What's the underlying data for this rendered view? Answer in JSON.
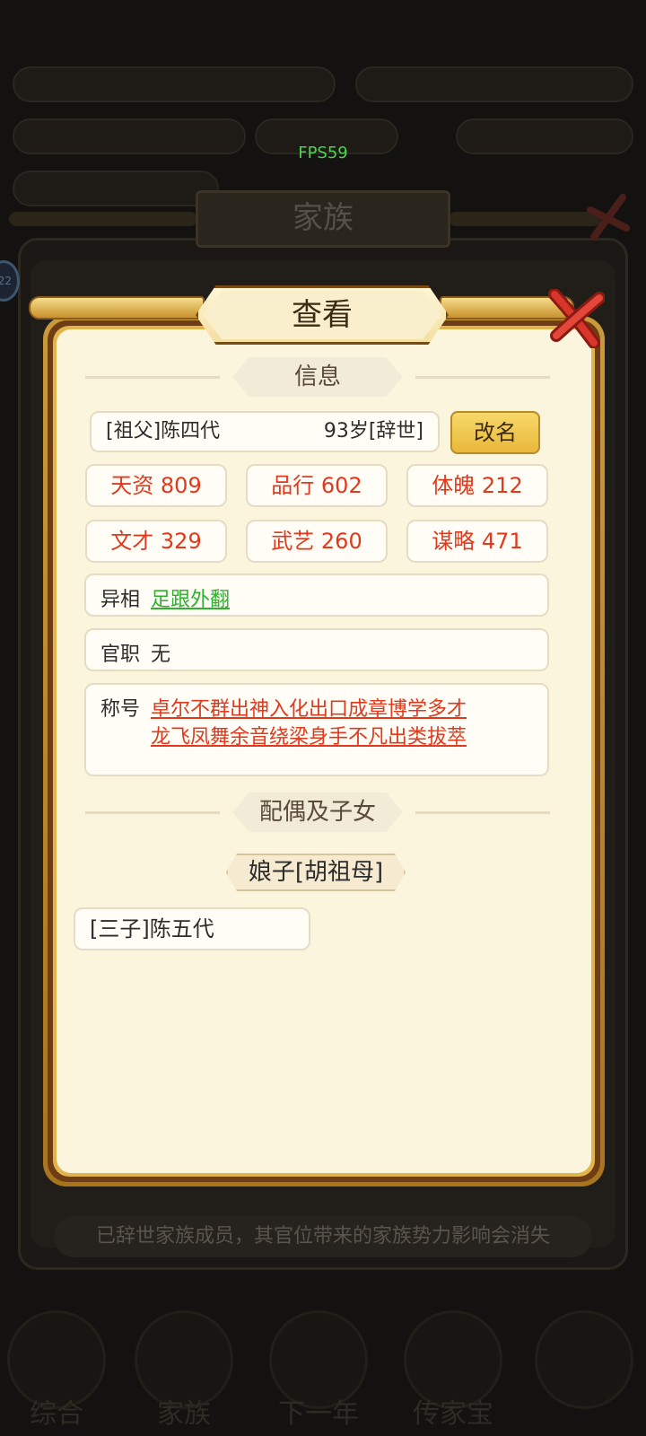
{
  "fps": "FPS59",
  "background": {
    "window_title": "家族",
    "notice": "已辞世家族成员，其官位带来的家族势力影响会消失",
    "nav_labels": [
      "综合",
      "家族",
      "下一年",
      "传家宝",
      "..."
    ]
  },
  "dialog": {
    "title": "查看",
    "section_info": "信息",
    "member": {
      "name": "[祖父]陈四代",
      "age_status": "93岁[辞世]"
    },
    "rename_label": "改名",
    "stats": [
      {
        "text": "天资 809"
      },
      {
        "text": "品行 602"
      },
      {
        "text": "体魄 212"
      },
      {
        "text": "文才 329"
      },
      {
        "text": "武艺 260"
      },
      {
        "text": "谋略 471"
      }
    ],
    "trait": {
      "label": "异相",
      "value": "足跟外翻"
    },
    "office": {
      "label": "官职",
      "value": "无"
    },
    "titles": {
      "label": "称号",
      "line1": "卓尔不群出神入化出口成章博学多才",
      "line2": "龙飞凤舞余音绕梁身手不凡出类拔萃"
    },
    "section_family": "配偶及子女",
    "spouse": "娘子[胡祖母]",
    "children": [
      "[三子]陈五代"
    ]
  },
  "colors": {
    "accent_gold": "#e8b83a",
    "stat_red": "#e0391d",
    "trait_green": "#2fb02f",
    "panel_cream": "#fbf5dd"
  }
}
